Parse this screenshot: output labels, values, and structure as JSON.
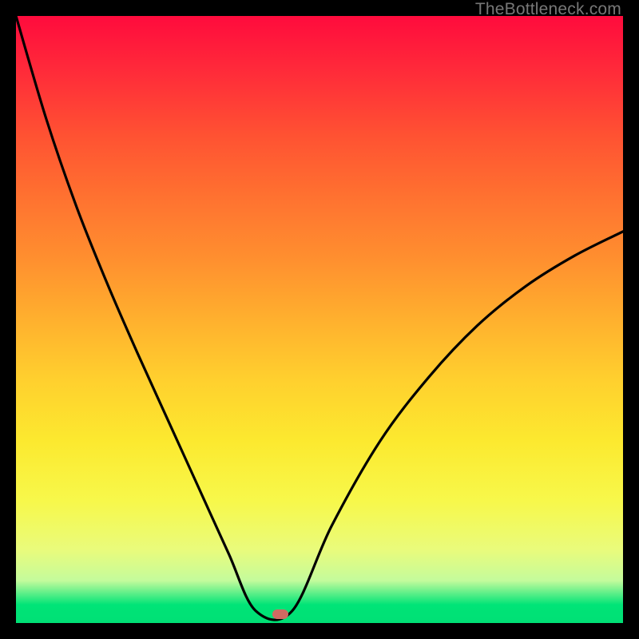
{
  "watermark": "TheBottleneck.com",
  "marker": {
    "x_frac": 0.435,
    "y_frac": 0.985
  },
  "colors": {
    "frame": "#000000",
    "curve": "#000000",
    "marker": "#cf6a62",
    "gradient_top": "#ff0b3d",
    "gradient_bottom": "#00e075"
  },
  "chart_data": {
    "type": "line",
    "title": "",
    "xlabel": "",
    "ylabel": "",
    "xlim": [
      0,
      1
    ],
    "ylim": [
      0,
      1
    ],
    "series": [
      {
        "name": "left-branch",
        "x": [
          0.0,
          0.05,
          0.1,
          0.15,
          0.2,
          0.25,
          0.3,
          0.35,
          0.395
        ],
        "y": [
          1.0,
          0.83,
          0.685,
          0.56,
          0.445,
          0.335,
          0.225,
          0.115,
          0.02
        ]
      },
      {
        "name": "valley-floor",
        "x": [
          0.395,
          0.455
        ],
        "y": [
          0.02,
          0.02
        ]
      },
      {
        "name": "right-branch",
        "x": [
          0.455,
          0.52,
          0.6,
          0.68,
          0.76,
          0.84,
          0.92,
          1.0
        ],
        "y": [
          0.02,
          0.16,
          0.3,
          0.405,
          0.49,
          0.555,
          0.605,
          0.645
        ]
      }
    ],
    "annotations": [
      {
        "name": "optimum-marker",
        "x": 0.435,
        "y": 0.015
      }
    ]
  }
}
